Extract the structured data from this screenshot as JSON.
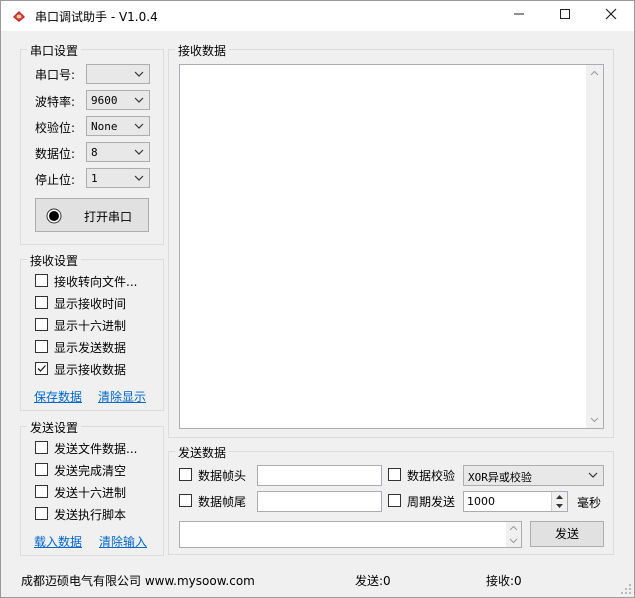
{
  "window": {
    "title": "串口调试助手 - V1.0.4",
    "controls": {
      "minimize": "—",
      "maximize": "☐",
      "close": "✕"
    }
  },
  "serial_settings": {
    "title": "串口设置",
    "port_label": "串口号:",
    "port_value": "",
    "baud_label": "波特率:",
    "baud_value": "9600",
    "parity_label": "校验位:",
    "parity_value": "None",
    "databits_label": "数据位:",
    "databits_value": "8",
    "stopbits_label": "停止位:",
    "stopbits_value": "1",
    "open_button": "打开串口"
  },
  "receive_settings": {
    "title": "接收设置",
    "options": [
      {
        "label": "接收转向文件...",
        "checked": false
      },
      {
        "label": "显示接收时间",
        "checked": false
      },
      {
        "label": "显示十六进制",
        "checked": false
      },
      {
        "label": "显示发送数据",
        "checked": false
      },
      {
        "label": "显示接收数据",
        "checked": true
      }
    ],
    "save_link": "保存数据",
    "clear_link": "清除显示"
  },
  "send_settings": {
    "title": "发送设置",
    "options": [
      {
        "label": "发送文件数据...",
        "checked": false
      },
      {
        "label": "发送完成清空",
        "checked": false
      },
      {
        "label": "发送十六进制",
        "checked": false
      },
      {
        "label": "发送执行脚本",
        "checked": false
      }
    ],
    "load_link": "载入数据",
    "clear_link": "清除输入"
  },
  "receive_data": {
    "title": "接收数据",
    "content": ""
  },
  "send_data": {
    "title": "发送数据",
    "frame_head_label": "数据帧头",
    "frame_head_value": "",
    "frame_tail_label": "数据帧尾",
    "frame_tail_value": "",
    "checksum_label": "数据校验",
    "checksum_value": "XOR异或校验",
    "period_label": "周期发送",
    "period_value": "1000",
    "period_unit": "毫秒",
    "input_value": "",
    "send_button": "发送"
  },
  "status": {
    "company": "成都迈硕电气有限公司 www.mysoow.com",
    "sent": "发送:0",
    "received": "接收:0"
  },
  "colors": {
    "link": "#0066cc",
    "icon_red": "#c0282d",
    "background": "#f0f0f0"
  }
}
